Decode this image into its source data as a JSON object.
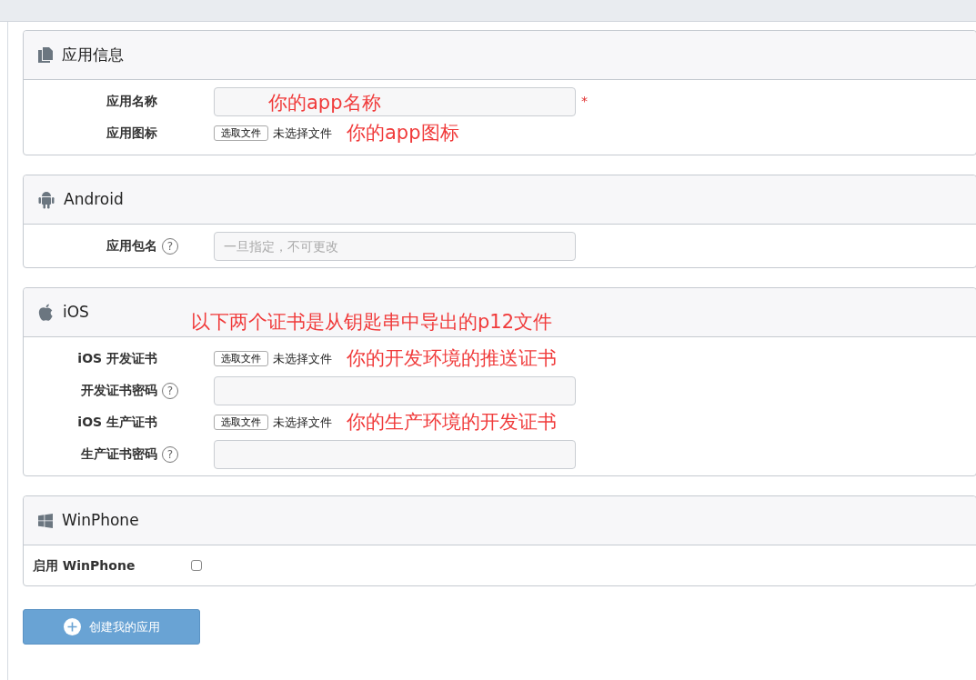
{
  "panels": [
    {
      "kind": "docs",
      "title": "应用信息",
      "rows": [
        {
          "kind": "input",
          "label": "应用名称",
          "required_mark": "*",
          "annotation": "你的app名称"
        },
        {
          "kind": "file",
          "label": "应用图标",
          "button": "选取文件",
          "status": "未选择文件",
          "annotation": "你的app图标"
        }
      ]
    },
    {
      "kind": "android",
      "title": "Android",
      "rows": [
        {
          "kind": "input",
          "label": "应用包名",
          "help": "?",
          "placeholder": "一旦指定，不可更改"
        }
      ]
    },
    {
      "kind": "apple",
      "title": "iOS",
      "note": "以下两个证书是从钥匙串中导出的p12文件",
      "rows": [
        {
          "kind": "file",
          "label": "iOS 开发证书",
          "button": "选取文件",
          "status": "未选择文件",
          "annotation": "你的开发环境的推送证书"
        },
        {
          "kind": "input",
          "label": "开发证书密码",
          "help": "?"
        },
        {
          "kind": "file",
          "label": "iOS 生产证书",
          "button": "选取文件",
          "status": "未选择文件",
          "annotation": "你的生产环境的开发证书"
        },
        {
          "kind": "input",
          "label": "生产证书密码",
          "help": "?"
        }
      ]
    },
    {
      "kind": "windows",
      "title": "WinPhone",
      "rows": [
        {
          "kind": "checkbox",
          "label": "启用 WinPhone",
          "checked": false
        }
      ]
    }
  ],
  "submit": "创建我的应用"
}
